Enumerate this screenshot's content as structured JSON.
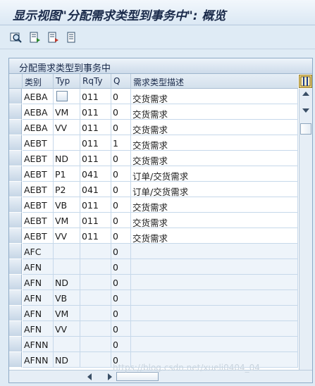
{
  "title": "显示视图\"分配需求类型到事务中\": 概览",
  "toolbar": {
    "icons": [
      "details-icon",
      "save-layout-icon",
      "export-icon",
      "print-icon"
    ]
  },
  "panel": {
    "title": "分配需求类型到事务中"
  },
  "table": {
    "columns": [
      "类别",
      "Typ",
      "RqTy",
      "Q",
      "需求类型描述"
    ],
    "rows": [
      {
        "cat": "AEBA",
        "typ": "",
        "rqty": "011",
        "q": "0",
        "desc": "交货需求"
      },
      {
        "cat": "AEBA",
        "typ": "VM",
        "rqty": "011",
        "q": "0",
        "desc": "交货需求"
      },
      {
        "cat": "AEBA",
        "typ": "VV",
        "rqty": "011",
        "q": "0",
        "desc": "交货需求"
      },
      {
        "cat": "AEBT",
        "typ": "",
        "rqty": "011",
        "q": "1",
        "desc": "交货需求"
      },
      {
        "cat": "AEBT",
        "typ": "ND",
        "rqty": "011",
        "q": "0",
        "desc": "交货需求"
      },
      {
        "cat": "AEBT",
        "typ": "P1",
        "rqty": "041",
        "q": "0",
        "desc": "订单/交货需求"
      },
      {
        "cat": "AEBT",
        "typ": "P2",
        "rqty": "041",
        "q": "0",
        "desc": "订单/交货需求"
      },
      {
        "cat": "AEBT",
        "typ": "VB",
        "rqty": "011",
        "q": "0",
        "desc": "交货需求"
      },
      {
        "cat": "AEBT",
        "typ": "VM",
        "rqty": "011",
        "q": "0",
        "desc": "交货需求"
      },
      {
        "cat": "AEBT",
        "typ": "VV",
        "rqty": "011",
        "q": "0",
        "desc": "交货需求"
      },
      {
        "cat": "AFC",
        "typ": "",
        "rqty": "",
        "q": "0",
        "desc": ""
      },
      {
        "cat": "AFN",
        "typ": "",
        "rqty": "",
        "q": "0",
        "desc": ""
      },
      {
        "cat": "AFN",
        "typ": "ND",
        "rqty": "",
        "q": "0",
        "desc": ""
      },
      {
        "cat": "AFN",
        "typ": "VB",
        "rqty": "",
        "q": "0",
        "desc": ""
      },
      {
        "cat": "AFN",
        "typ": "VM",
        "rqty": "",
        "q": "0",
        "desc": ""
      },
      {
        "cat": "AFN",
        "typ": "VV",
        "rqty": "",
        "q": "0",
        "desc": ""
      },
      {
        "cat": "AFNN",
        "typ": "",
        "rqty": "",
        "q": "0",
        "desc": ""
      },
      {
        "cat": "AFNN",
        "typ": "ND",
        "rqty": "",
        "q": "0",
        "desc": ""
      }
    ]
  },
  "watermark": "https://blog.csdn.net/xueli0404_04"
}
